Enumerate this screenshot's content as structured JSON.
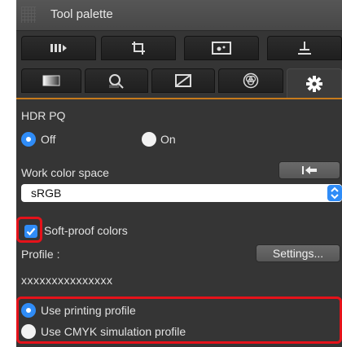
{
  "window": {
    "title": "Tool palette"
  },
  "tabs": {
    "row1": [
      {
        "icon": "tone-curve-icon"
      },
      {
        "icon": "crop-icon"
      },
      {
        "icon": "image-icon"
      },
      {
        "icon": "stamp-icon"
      }
    ],
    "row2": [
      {
        "icon": "gradient-icon"
      },
      {
        "icon": "lens-correction-icon"
      },
      {
        "icon": "tone-adjust-icon"
      },
      {
        "icon": "color-icon"
      },
      {
        "icon": "settings-gear-icon",
        "active": true
      }
    ]
  },
  "hdr": {
    "label": "HDR PQ",
    "options": [
      "Off",
      "On"
    ],
    "selected": "Off"
  },
  "work_color_space": {
    "label": "Work color space",
    "value": "sRGB",
    "reset_icon": "reset-arrow-icon"
  },
  "soft_proof": {
    "label": "Soft-proof colors",
    "checked": true,
    "profile_label": "Profile :",
    "settings_button": "Settings...",
    "profile_value": "xxxxxxxxxxxxxxx"
  },
  "proof_mode": {
    "options": [
      "Use printing profile",
      "Use CMYK simulation profile"
    ],
    "selected": "Use printing profile"
  },
  "colors": {
    "accent": "#2f8cf7",
    "highlight": "#e5121a",
    "active_tab_line": "#c77b1c"
  }
}
